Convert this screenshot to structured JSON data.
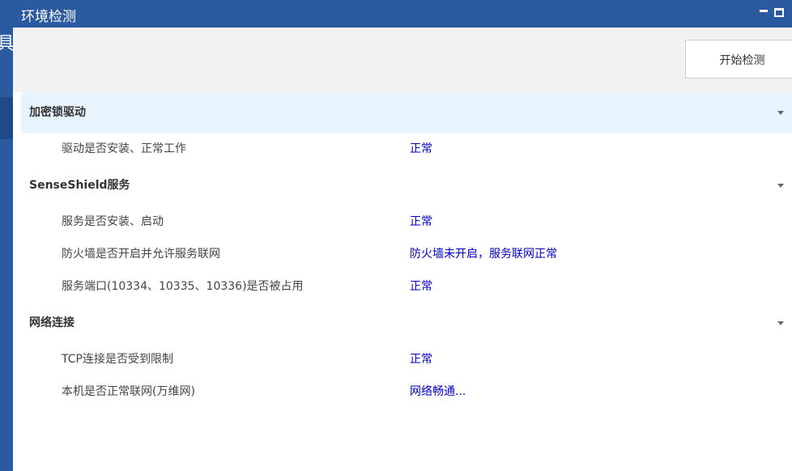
{
  "background": {
    "sidebar_char": "具"
  },
  "window": {
    "title": "环境检测"
  },
  "toolbar": {
    "start_label": "开始检测"
  },
  "sections": [
    {
      "title": "加密锁驱动",
      "rows": [
        {
          "label": "驱动是否安装、正常工作",
          "value": "正常"
        }
      ]
    },
    {
      "title": "SenseShield服务",
      "rows": [
        {
          "label": "服务是否安装、启动",
          "value": "正常"
        },
        {
          "label": "防火墙是否开启并允许服务联网",
          "value": "防火墙未开启，服务联网正常"
        },
        {
          "label": "服务端口(10334、10335、10336)是否被占用",
          "value": "正常"
        }
      ]
    },
    {
      "title": "网络连接",
      "rows": [
        {
          "label": "TCP连接是否受到限制",
          "value": "正常"
        },
        {
          "label": "本机是否正常联网(万维网)",
          "value": "网络畅通..."
        }
      ]
    }
  ],
  "colors": {
    "titlebar": "#2c5aa0",
    "active_section": "#e8f4fd",
    "value_text": "#0000c8"
  }
}
